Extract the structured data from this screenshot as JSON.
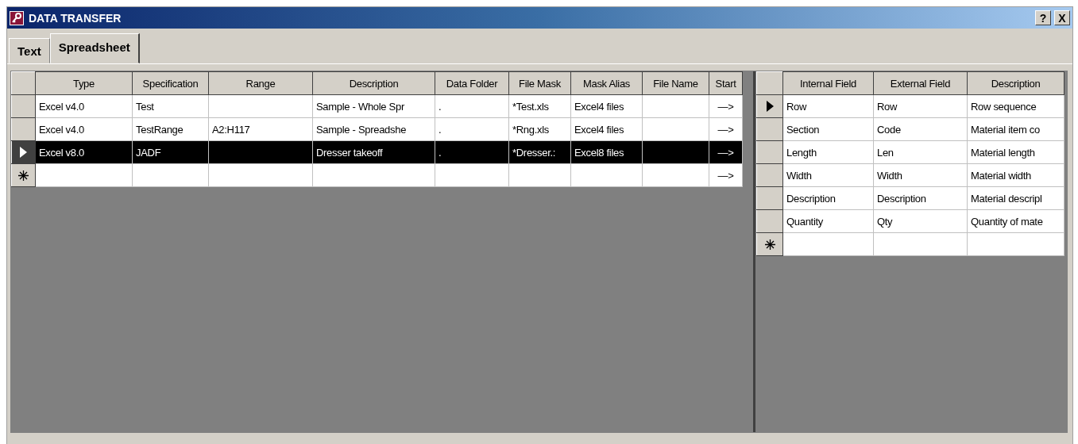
{
  "window": {
    "title": "DATA TRANSFER",
    "help_button": "?",
    "close_button": "X"
  },
  "tabs": [
    {
      "label": "Text",
      "selected": false
    },
    {
      "label": "Spreadsheet",
      "selected": true
    }
  ],
  "specs_grid": {
    "columns": [
      "Type",
      "Specification",
      "Range",
      "Description",
      "Data Folder",
      "File Mask",
      "Mask Alias",
      "File Name",
      "Start"
    ],
    "rows": [
      {
        "selected": false,
        "cells": [
          "Excel v4.0",
          "Test",
          "",
          "Sample - Whole Spr",
          ".",
          "*Test.xls",
          "Excel4 files",
          "",
          "—>"
        ]
      },
      {
        "selected": false,
        "cells": [
          "Excel v4.0",
          "TestRange",
          "A2:H117",
          "Sample - Spreadshe",
          ".",
          "*Rng.xls",
          "Excel4 files",
          "",
          "—>"
        ]
      },
      {
        "selected": true,
        "cells": [
          "Excel v8.0",
          "JADF",
          "",
          "Dresser takeoff",
          ".",
          "*Dresser.:",
          "Excel8 files",
          "",
          "—>"
        ]
      }
    ],
    "new_row": {
      "start": "—>"
    }
  },
  "fields_grid": {
    "columns": [
      "Internal Field",
      "External Field",
      "Description"
    ],
    "rows": [
      {
        "current": true,
        "cells": [
          "Row",
          "Row",
          "Row sequence"
        ]
      },
      {
        "current": false,
        "cells": [
          "Section",
          "Code",
          "Material item co"
        ]
      },
      {
        "current": false,
        "cells": [
          "Length",
          "Len",
          "Material length"
        ]
      },
      {
        "current": false,
        "cells": [
          "Width",
          "Width",
          "Material width"
        ]
      },
      {
        "current": false,
        "cells": [
          "Description",
          "Description",
          "Material descripl"
        ]
      },
      {
        "current": false,
        "cells": [
          "Quantity",
          "Qty",
          "Quantity of mate"
        ]
      }
    ]
  }
}
